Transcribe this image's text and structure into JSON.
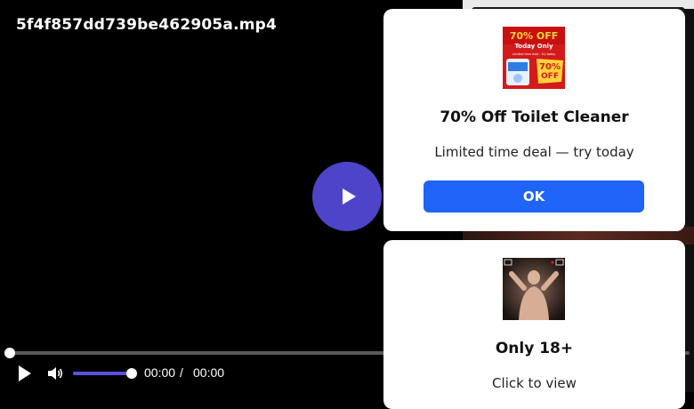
{
  "player": {
    "file_name": "5f4f857dd739be462905a.mp4",
    "current_time": "00:00",
    "separator": "/",
    "duration": "00:00",
    "progress": 0,
    "volume": 1.0,
    "accent_color": "#4e44c9"
  },
  "ads": [
    {
      "thumb_lines": [
        "70% OFF",
        "Today Only",
        "Limited time deal - try today",
        "70%",
        "OFF"
      ],
      "title": "70% Off Toilet Cleaner",
      "text": "Limited time deal — try today",
      "button_label": "OK",
      "button_color": "#1f63f7"
    },
    {
      "title": "Only 18+",
      "text": "Click to view"
    }
  ]
}
